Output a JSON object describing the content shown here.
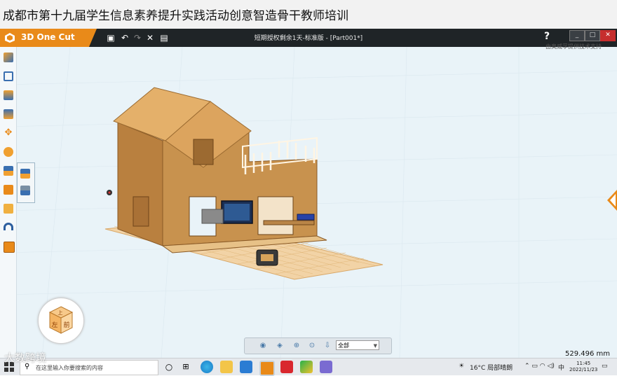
{
  "slide_title": "成都市第十九届学生信息素养提升实践活动创意智造骨干教师培训",
  "app": {
    "logo_text": "3D One Cut",
    "document_title": "短期授权剩余1天-标准版 - [Part001*]",
    "help_label": "?",
    "support_text": "由奥威孚提供技术支持",
    "window_buttons": [
      "_",
      "□",
      "✕"
    ]
  },
  "viewcube": {
    "faces": [
      "左",
      "前",
      "上"
    ]
  },
  "bottom_toolbar": {
    "selector_value": "全部"
  },
  "measurement": "529.496 mm",
  "taskbar": {
    "search_placeholder": "在这里输入你要搜索的内容",
    "weather": "16°C 局部晴朗",
    "ime": "中",
    "time": "11:45",
    "date": "2022/11/23"
  },
  "watermark": "大数跨境",
  "colors": {
    "accent": "#e98a19",
    "titlebar": "#1f2427",
    "canvas": "#e9f3f8",
    "wood": "#c8924e",
    "wood_light": "#e4b06a"
  }
}
